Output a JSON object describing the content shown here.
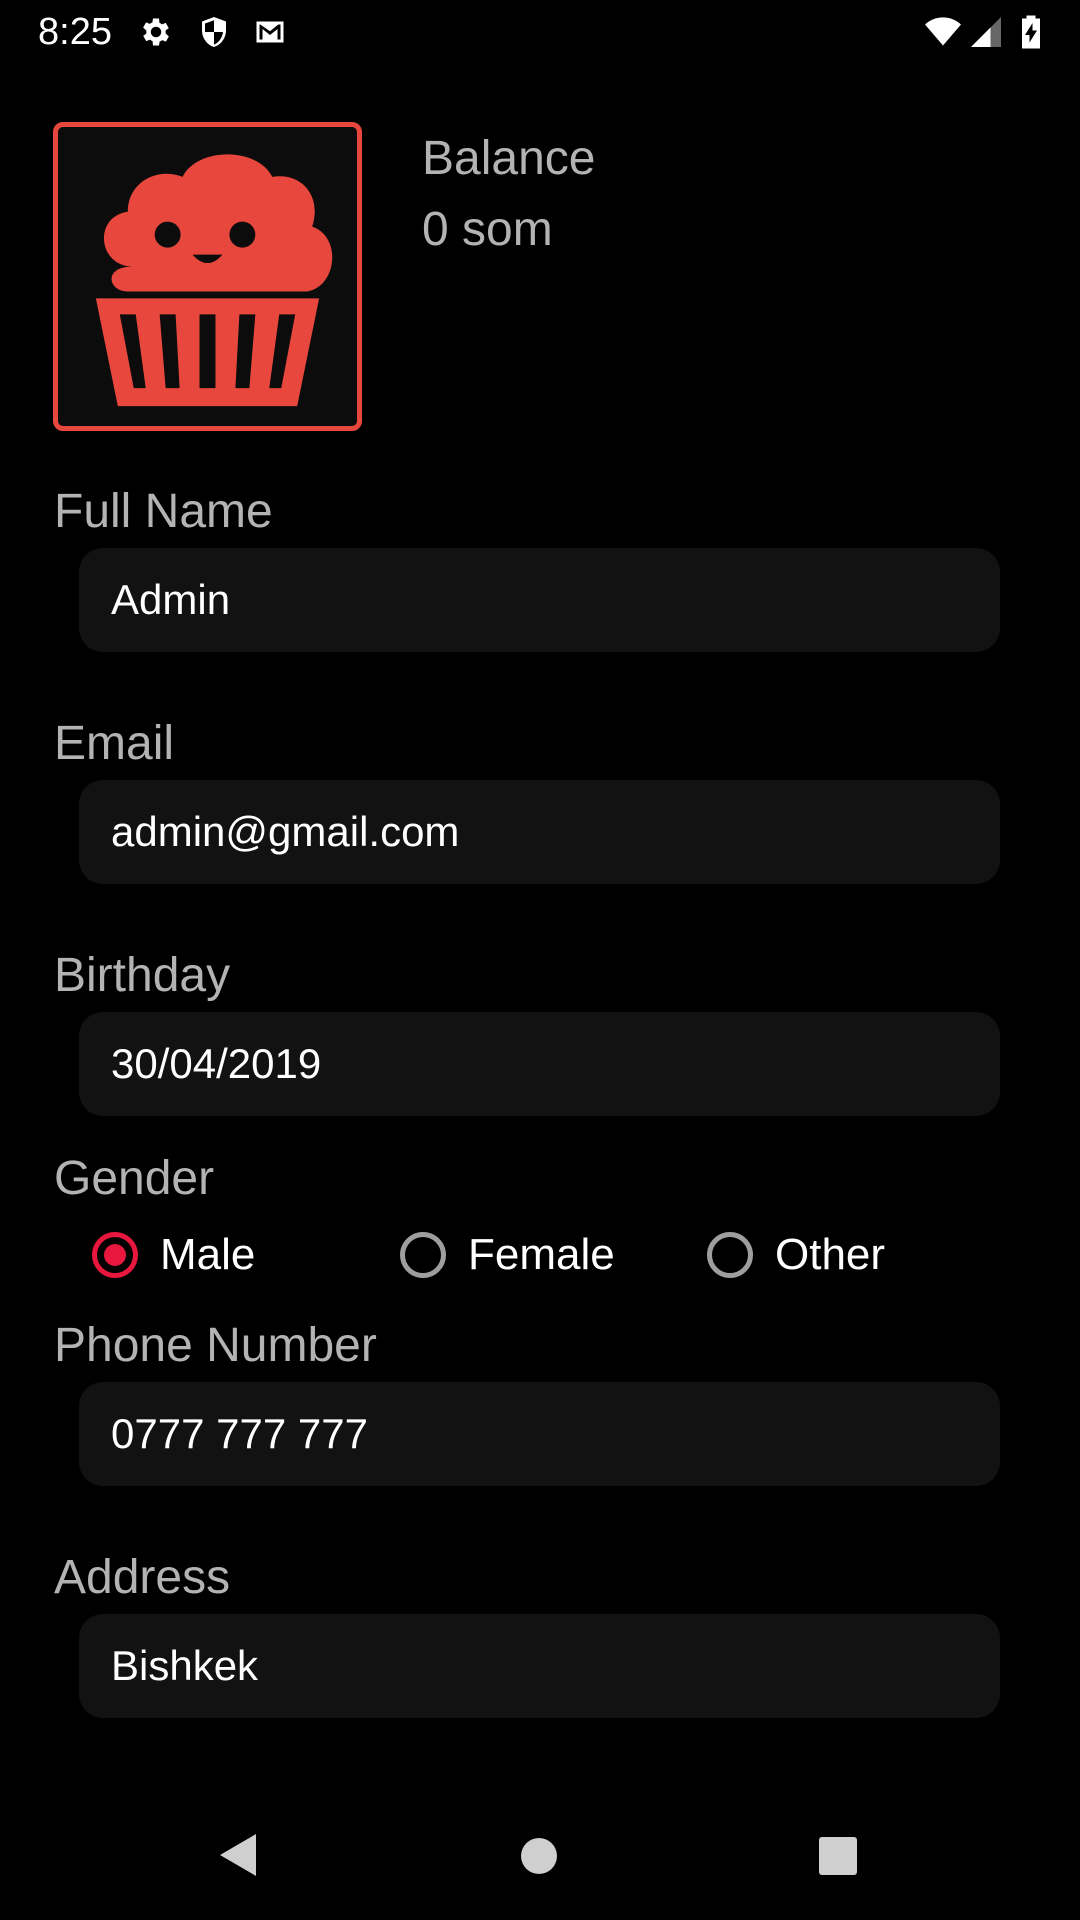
{
  "status_bar": {
    "time": "8:25",
    "left_icons": [
      "gear-icon",
      "shield-icon",
      "gmail-icon"
    ],
    "right_icons": [
      "wifi-icon",
      "cell-signal-icon",
      "battery-charging-icon"
    ]
  },
  "profile": {
    "avatar_icon": "cupcake-logo",
    "balance_label": "Balance",
    "balance_value": "0 som"
  },
  "fields": {
    "full_name": {
      "label": "Full Name",
      "value": "Admin"
    },
    "email": {
      "label": "Email",
      "value": "admin@gmail.com"
    },
    "birthday": {
      "label": "Birthday",
      "value": "30/04/2019"
    },
    "phone": {
      "label": "Phone Number",
      "value": "0777 777 777"
    },
    "address": {
      "label": "Address",
      "value": "Bishkek"
    }
  },
  "gender": {
    "label": "Gender",
    "options": [
      {
        "label": "Male",
        "checked": true
      },
      {
        "label": "Female",
        "checked": false
      },
      {
        "label": "Other",
        "checked": false
      }
    ]
  },
  "nav_bar": {
    "icons": [
      "back-icon",
      "home-icon",
      "recents-icon"
    ]
  },
  "colors": {
    "background": "#000000",
    "accent": "#e8473d",
    "radio_selected": "#e8173d",
    "label_text": "#b3b3b3",
    "field_background": "#121212"
  }
}
